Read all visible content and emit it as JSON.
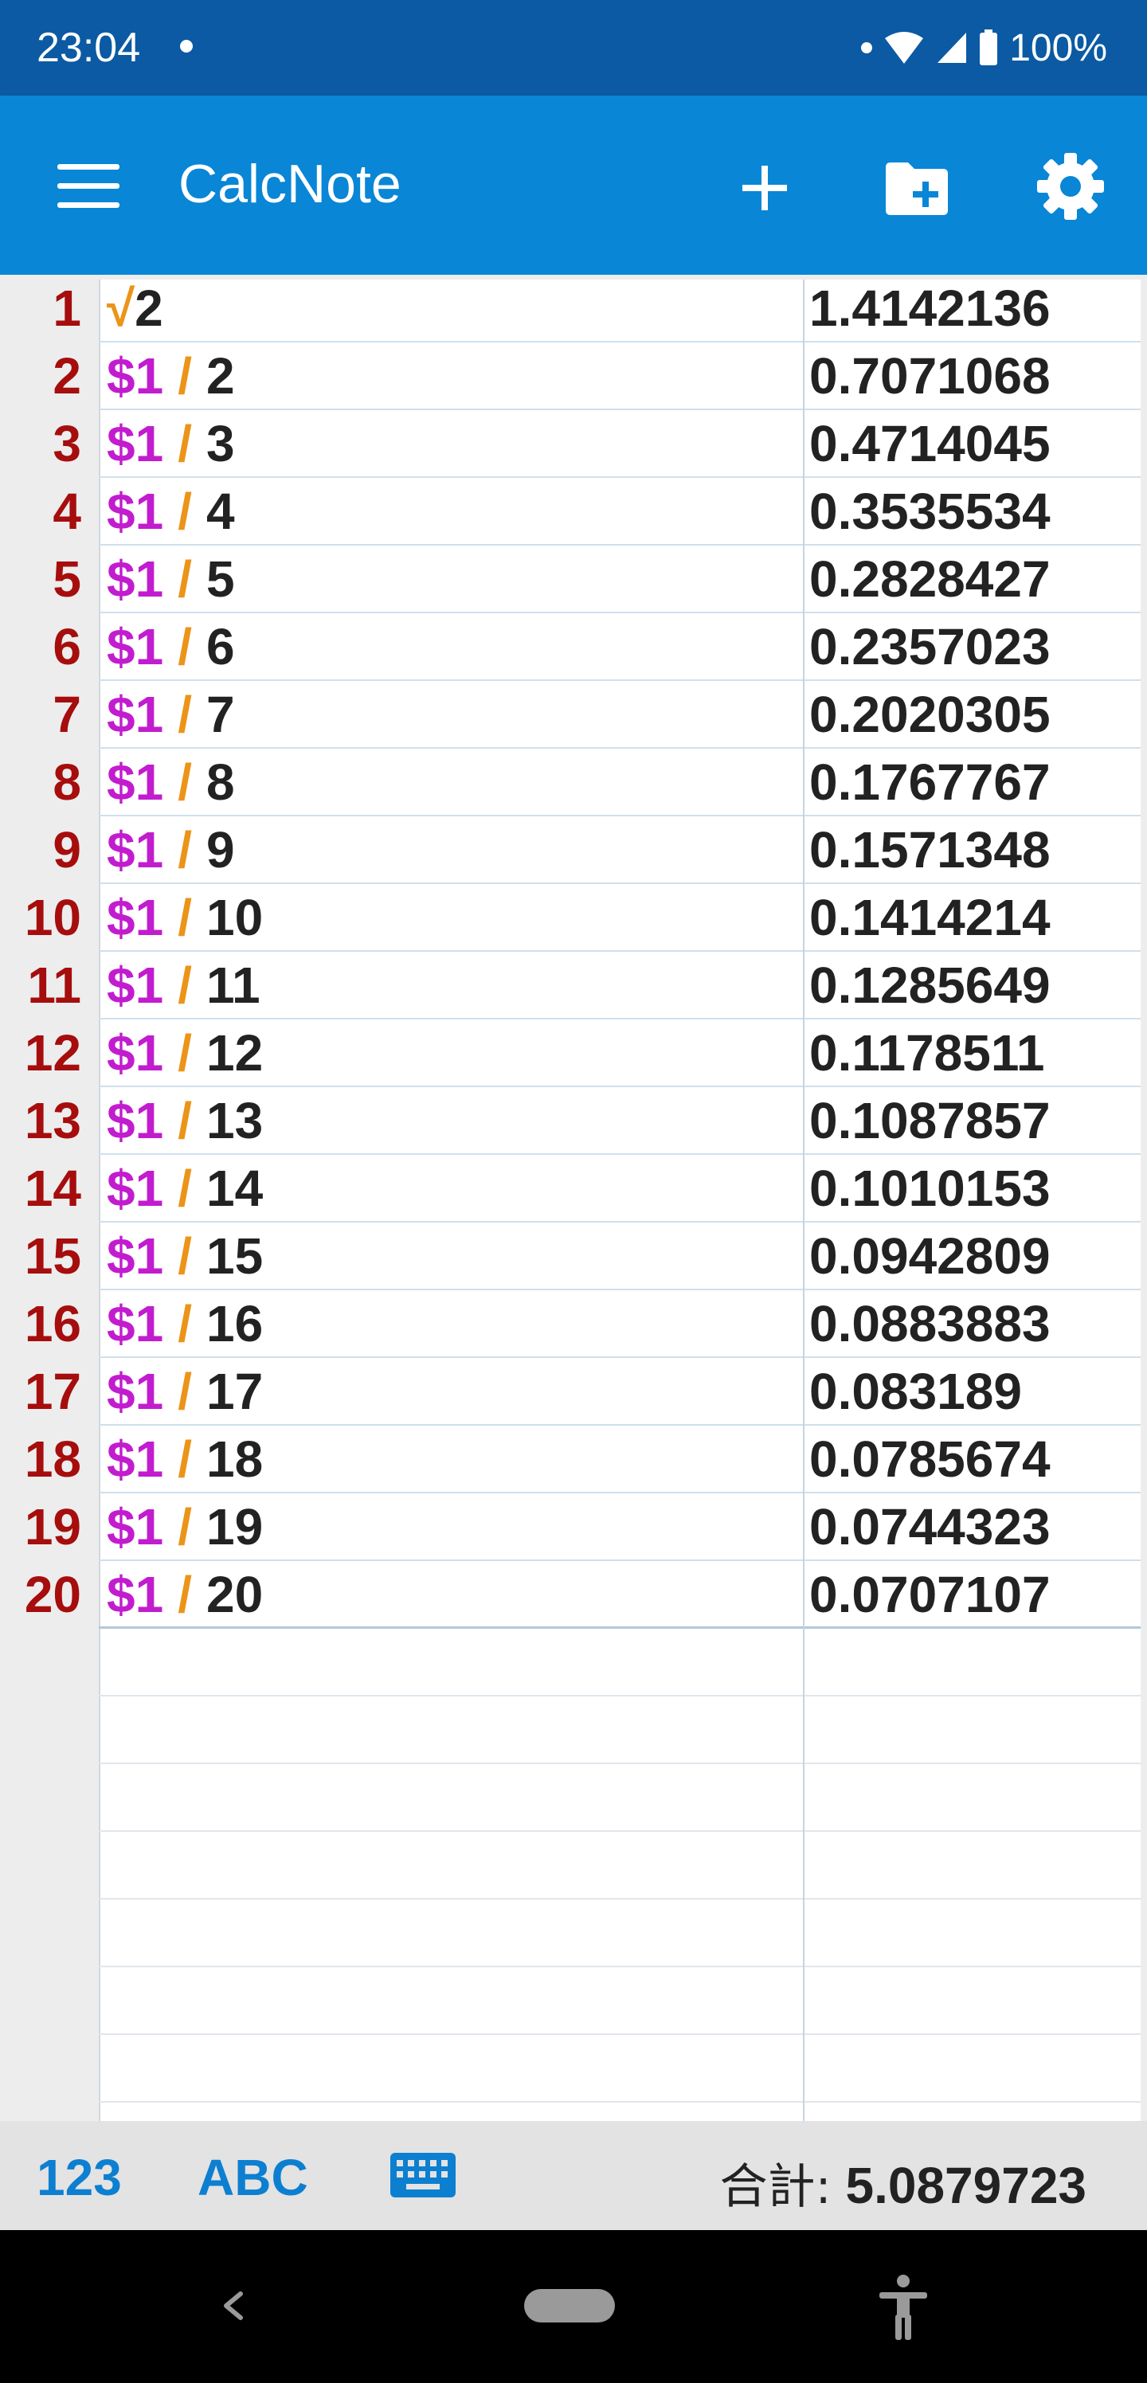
{
  "status_bar": {
    "time": "23:04",
    "battery": "100%"
  },
  "app_bar": {
    "title": "CalcNote"
  },
  "icons": {
    "menu": "menu-icon",
    "add": "add-icon",
    "new_folder": "create-new-folder-icon",
    "settings": "gear-icon",
    "keyboard": "keyboard-icon",
    "back": "back-icon",
    "accessibility": "accessibility-icon"
  },
  "colors": {
    "status_bar": "#0b5aa3",
    "app_bar": "#0986d6",
    "line_number": "#a60d0d",
    "reference": "#c21ccf",
    "operator": "#ec9418",
    "mode_button": "#0d7fd0"
  },
  "lines": [
    {
      "no": "1",
      "sqrt": "√",
      "ref": "",
      "op": "",
      "operand": "2",
      "result": "1.4142136"
    },
    {
      "no": "2",
      "sqrt": "",
      "ref": "$1",
      "op": "/",
      "operand": "2",
      "result": "0.7071068"
    },
    {
      "no": "3",
      "sqrt": "",
      "ref": "$1",
      "op": "/",
      "operand": "3",
      "result": "0.4714045"
    },
    {
      "no": "4",
      "sqrt": "",
      "ref": "$1",
      "op": "/",
      "operand": "4",
      "result": "0.3535534"
    },
    {
      "no": "5",
      "sqrt": "",
      "ref": "$1",
      "op": "/",
      "operand": "5",
      "result": "0.2828427"
    },
    {
      "no": "6",
      "sqrt": "",
      "ref": "$1",
      "op": "/",
      "operand": "6",
      "result": "0.2357023"
    },
    {
      "no": "7",
      "sqrt": "",
      "ref": "$1",
      "op": "/",
      "operand": "7",
      "result": "0.2020305"
    },
    {
      "no": "8",
      "sqrt": "",
      "ref": "$1",
      "op": "/",
      "operand": "8",
      "result": "0.1767767"
    },
    {
      "no": "9",
      "sqrt": "",
      "ref": "$1",
      "op": "/",
      "operand": "9",
      "result": "0.1571348"
    },
    {
      "no": "10",
      "sqrt": "",
      "ref": "$1",
      "op": "/",
      "operand": "10",
      "result": "0.1414214"
    },
    {
      "no": "11",
      "sqrt": "",
      "ref": "$1",
      "op": "/",
      "operand": "11",
      "result": "0.1285649"
    },
    {
      "no": "12",
      "sqrt": "",
      "ref": "$1",
      "op": "/",
      "operand": "12",
      "result": "0.1178511"
    },
    {
      "no": "13",
      "sqrt": "",
      "ref": "$1",
      "op": "/",
      "operand": "13",
      "result": "0.1087857"
    },
    {
      "no": "14",
      "sqrt": "",
      "ref": "$1",
      "op": "/",
      "operand": "14",
      "result": "0.1010153"
    },
    {
      "no": "15",
      "sqrt": "",
      "ref": "$1",
      "op": "/",
      "operand": "15",
      "result": "0.0942809"
    },
    {
      "no": "16",
      "sqrt": "",
      "ref": "$1",
      "op": "/",
      "operand": "16",
      "result": "0.0883883"
    },
    {
      "no": "17",
      "sqrt": "",
      "ref": "$1",
      "op": "/",
      "operand": "17",
      "result": "0.083189"
    },
    {
      "no": "18",
      "sqrt": "",
      "ref": "$1",
      "op": "/",
      "operand": "18",
      "result": "0.0785674"
    },
    {
      "no": "19",
      "sqrt": "",
      "ref": "$1",
      "op": "/",
      "operand": "19",
      "result": "0.0744323"
    },
    {
      "no": "20",
      "sqrt": "",
      "ref": "$1",
      "op": "/",
      "operand": "20",
      "result": "0.0707107"
    }
  ],
  "bottom_bar": {
    "mode_numeric": "123",
    "mode_text": "ABC",
    "total_label": "合計:",
    "total_value": "5.0879723"
  }
}
